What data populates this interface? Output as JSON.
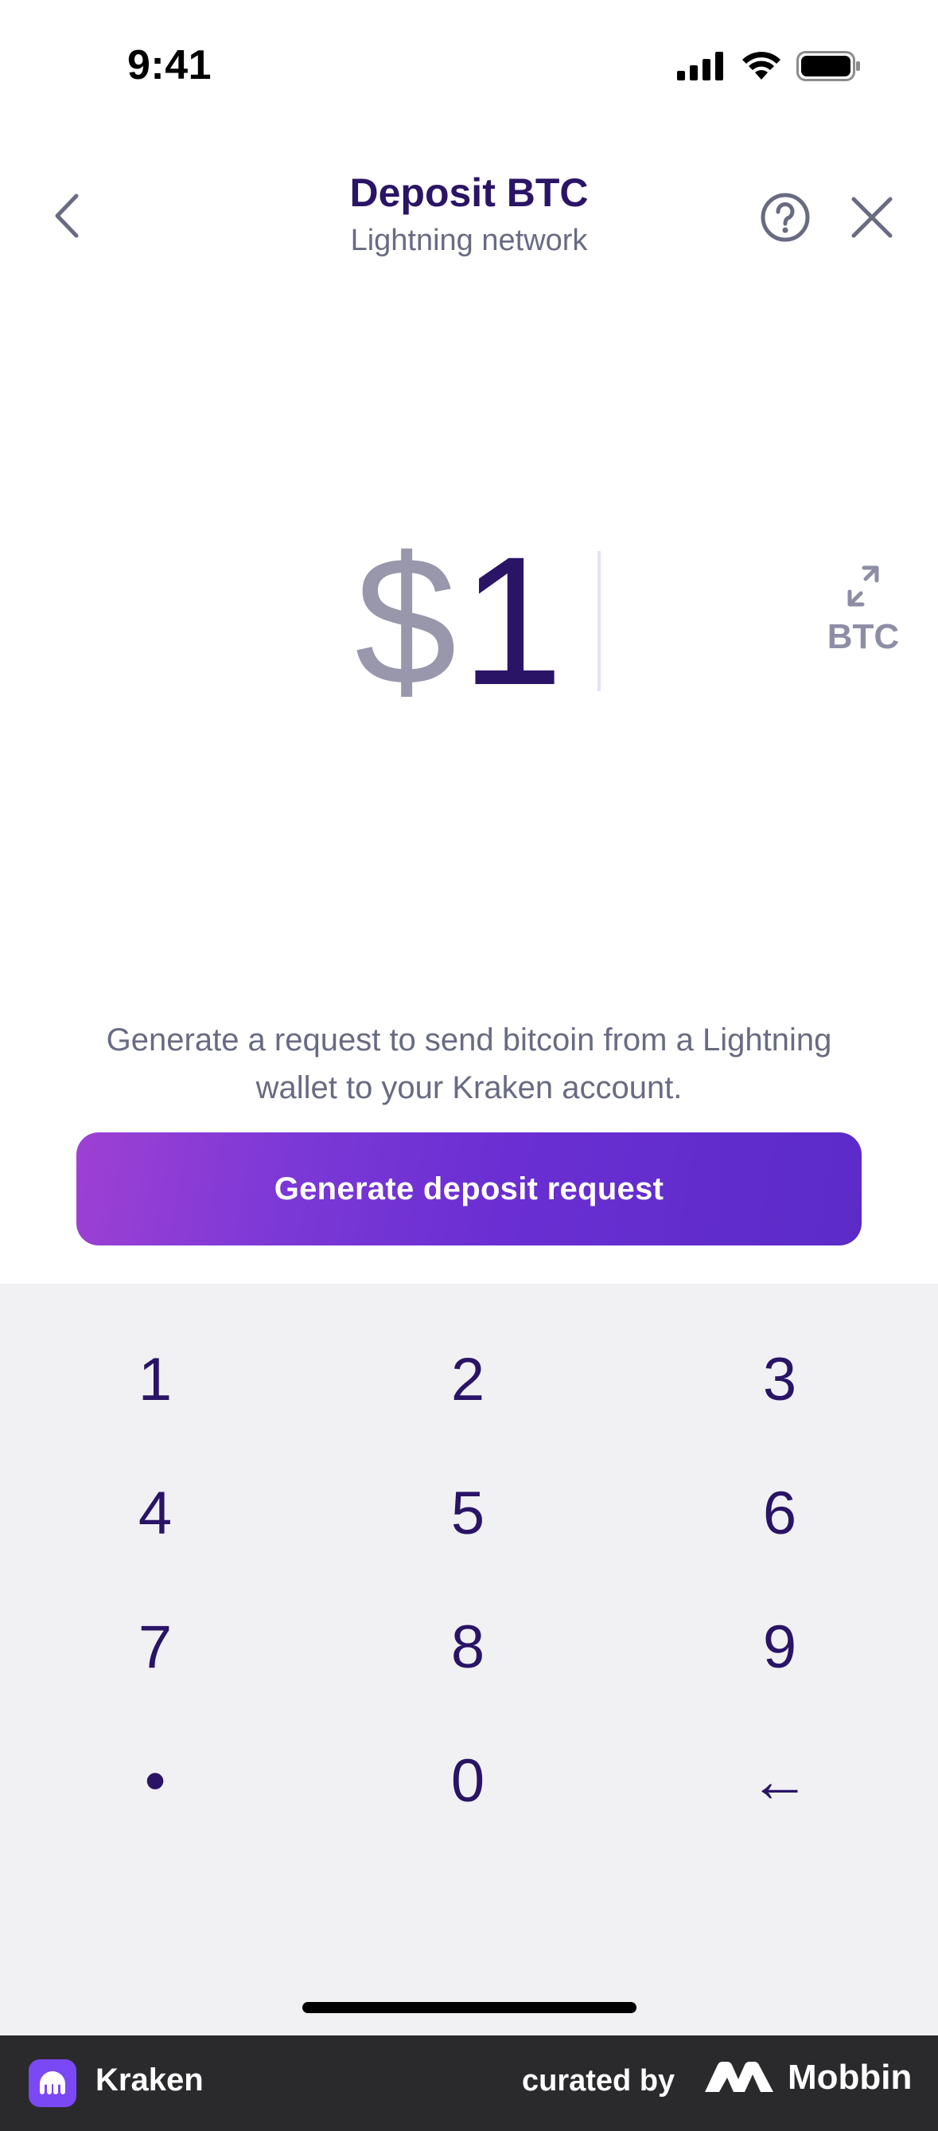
{
  "status_bar": {
    "time": "9:41"
  },
  "header": {
    "title": "Deposit BTC",
    "subtitle": "Lightning network",
    "icons": {
      "back": "chevron-left-icon",
      "help": "question-circle-icon",
      "close": "close-icon"
    }
  },
  "amount": {
    "currency_symbol": "$",
    "value": "1",
    "toggle_label": "BTC",
    "toggle_icon": "swap-arrows-icon"
  },
  "description": "Generate a request to send bitcoin from a Lightning wallet to your Kraken account.",
  "cta": {
    "label": "Generate deposit request"
  },
  "keypad": {
    "keys": [
      "1",
      "2",
      "3",
      "4",
      "5",
      "6",
      "7",
      "8",
      "9",
      "•",
      "0",
      "←"
    ]
  },
  "footer": {
    "app_name": "Kraken",
    "curated_by": "curated by",
    "brand": "Mobbin"
  },
  "colors": {
    "primary_text": "#2a1466",
    "secondary_text": "#686b82",
    "muted": "#9897ac",
    "accent_start": "#9e40d4",
    "accent_end": "#5b2bc8",
    "keypad_bg": "#f1f1f4"
  }
}
